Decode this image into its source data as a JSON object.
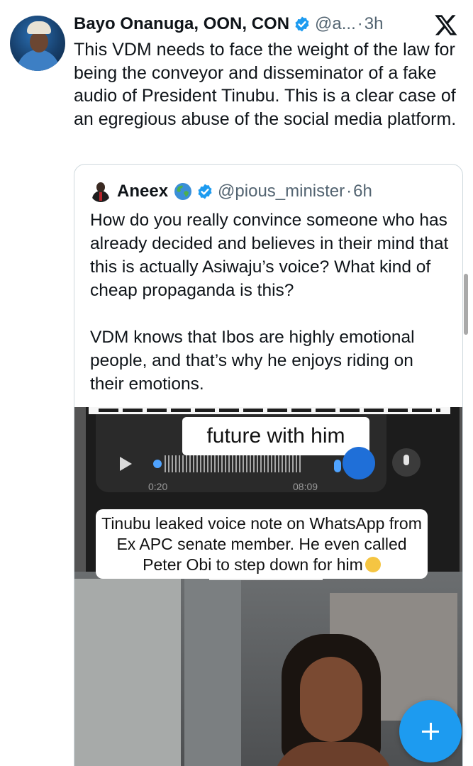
{
  "tweet": {
    "author": {
      "name": "Bayo Onanuga, OON, CON",
      "handle": "@a...",
      "time": "3h",
      "separator": "·"
    },
    "text": "This VDM needs to face the weight of the law for  being the conveyor and disseminator of a fake audio of President Tinubu. This is a clear case of an egregious abuse of the social media platform."
  },
  "quoted_tweet": {
    "author": {
      "name": "Aneex",
      "handle": "@pious_minister",
      "time": "6h",
      "separator": "·"
    },
    "text": "How do you really convince someone who has already decided and believes in their mind that this is actually Asiwaju’s voice? What kind of cheap propaganda is this?\n\nVDM knows that Ibos are highly emotional people, and that’s why he enjoys riding on their emotions.",
    "media": {
      "caption_top": "future with him",
      "voice_note": {
        "elapsed": "0:20",
        "duration": "08:09"
      },
      "caption_main": "Tinubu leaked voice note on WhatsApp from Ex APC senate member. He even called Peter Obi to step down for him"
    }
  },
  "colors": {
    "text": "#0f1419",
    "secondary": "#536471",
    "verified_blue": "#1d9bf0",
    "border": "#cfd9de",
    "fab": "#1d9bf0"
  },
  "icons": [
    "x-logo-icon",
    "verified-badge-icon",
    "globe-icon",
    "play-icon",
    "microphone-icon",
    "compose-plus-icon"
  ]
}
